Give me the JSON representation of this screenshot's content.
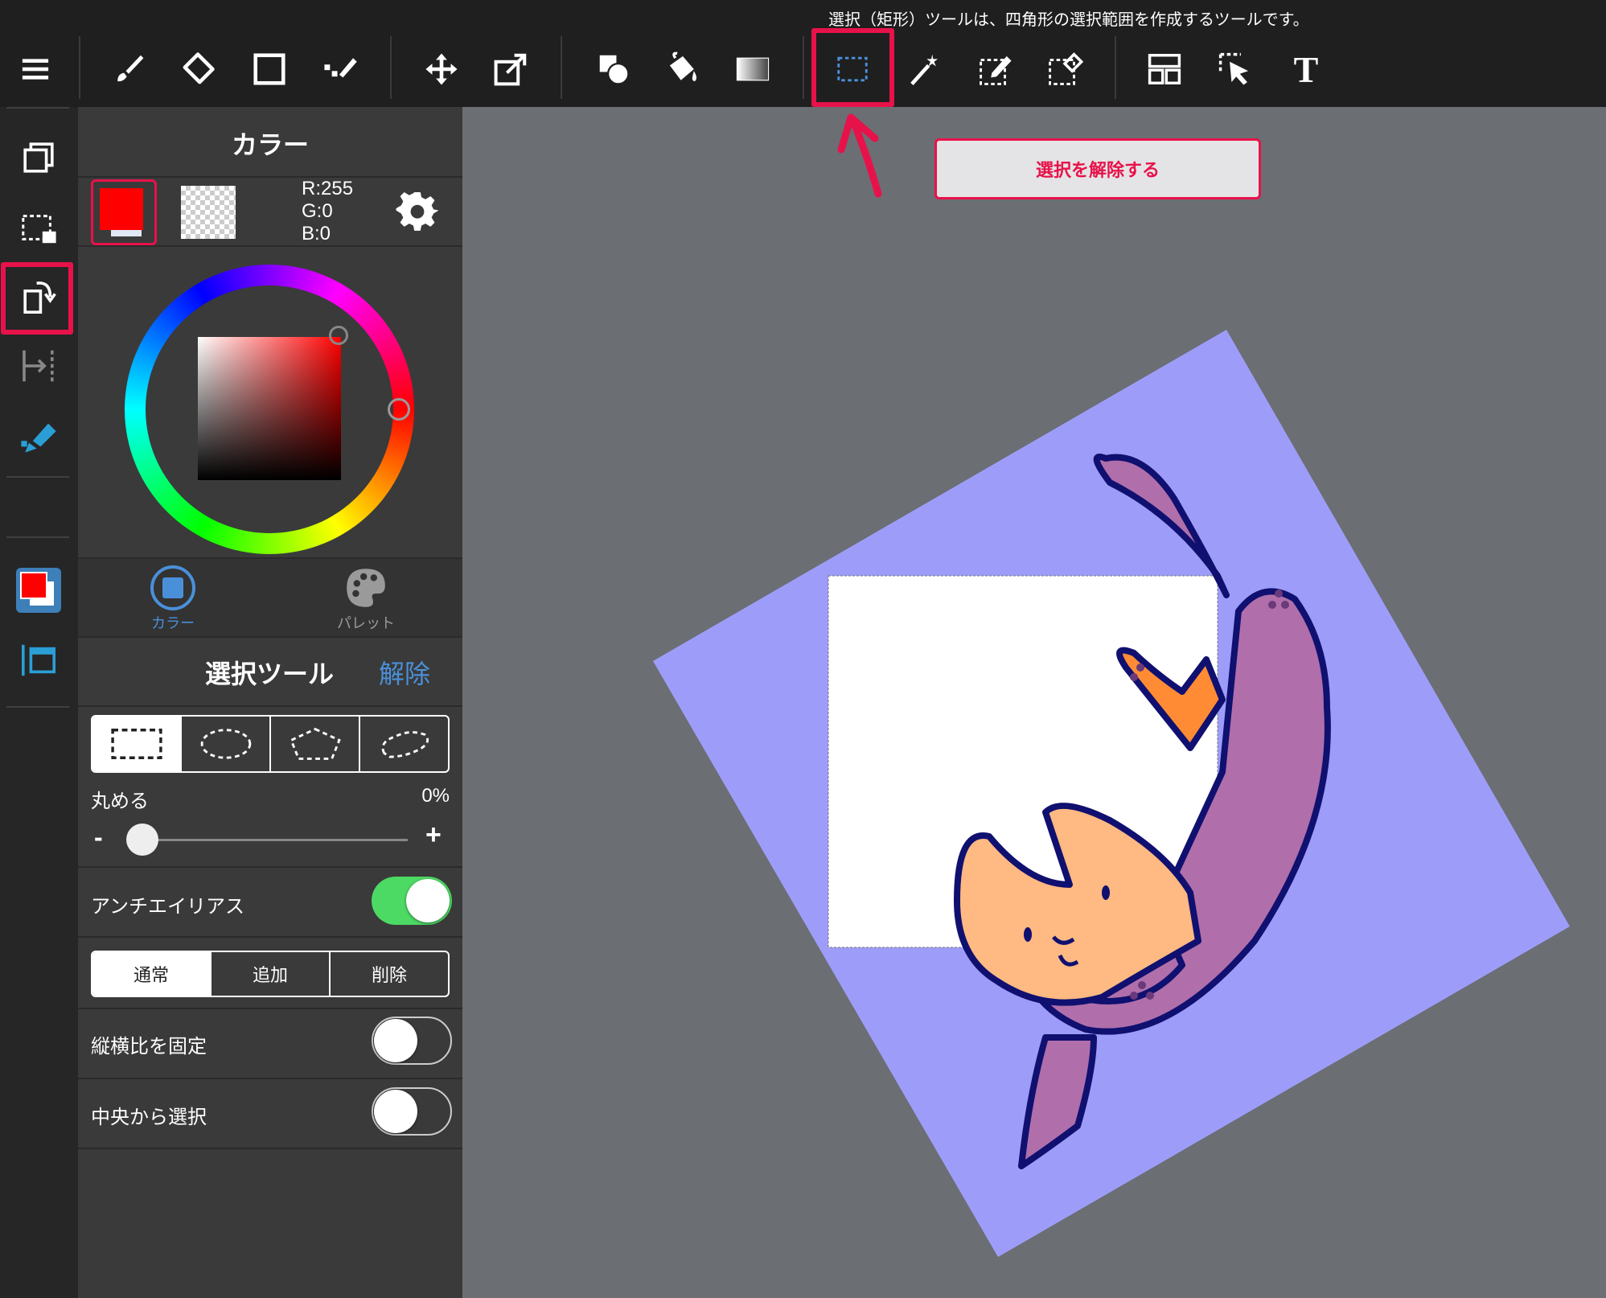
{
  "tooltip": "選択（矩形）ツールは、四角形の選択範囲を作成するツールです。",
  "toolbar": {
    "icons": [
      "menu-icon",
      "brush-icon",
      "eraser-icon",
      "shape-icon",
      "dot-pen-icon",
      "move-icon",
      "transform-icon",
      "fill-shapes-icon",
      "bucket-icon",
      "gradient-icon",
      "select-rect-icon",
      "magic-wand-icon",
      "select-pen-icon",
      "select-eraser-icon",
      "layout-icon",
      "select-arrow-icon",
      "text-icon"
    ],
    "text_tool_label": "T"
  },
  "left_bar": {
    "icons": [
      "layers-icon",
      "selection-layer-icon",
      "rotate-icon",
      "snap-icon",
      "brush-marker-icon",
      "color-swatch-icon",
      "frame-icon"
    ]
  },
  "color_panel": {
    "title": "カラー",
    "rgb": {
      "r": "R:255",
      "g": "G:0",
      "b": "B:0"
    },
    "foreground": "#ff0000",
    "tabs": {
      "color": "カラー",
      "palette": "パレット"
    }
  },
  "select_tool": {
    "title": "選択ツール",
    "release_label": "解除",
    "shape_modes": [
      "rect",
      "ellipse",
      "polygon",
      "lasso"
    ],
    "round_label": "丸める",
    "round_value": "0%",
    "round_fraction": 0,
    "slider_minus": "-",
    "slider_plus": "+",
    "antialias_label": "アンチエイリアス",
    "antialias_on": true,
    "mode_options": [
      "通常",
      "追加",
      "削除"
    ],
    "selected_mode": "通常",
    "aspect_label": "縦横比を固定",
    "aspect_on": false,
    "center_label": "中央から選択",
    "center_on": false
  },
  "canvas": {
    "unselect_button": "選択を解除する",
    "paper_color": "#9d9df9",
    "selection_fill": "#ffffff"
  },
  "colors": {
    "accent_red": "#e8124a",
    "blue_active": "#4a90d9",
    "toggle_on": "#4cd964"
  }
}
